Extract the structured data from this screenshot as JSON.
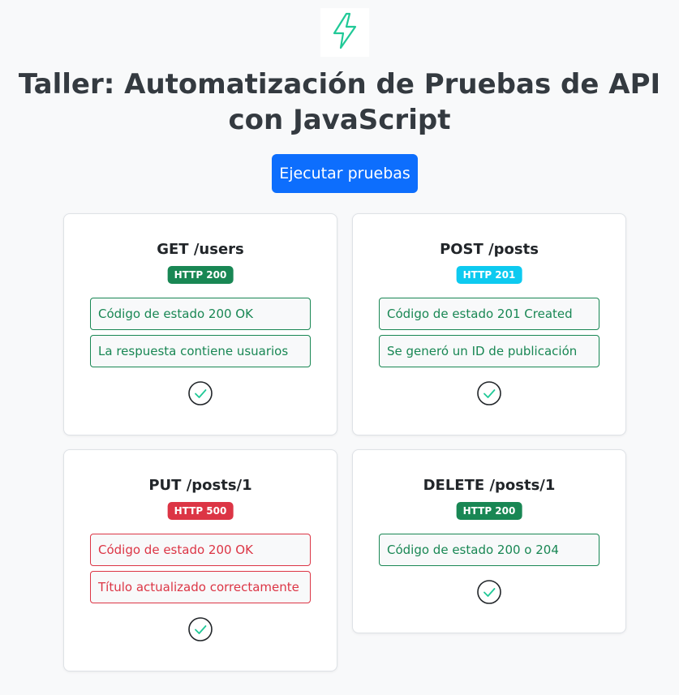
{
  "header": {
    "title": "Taller: Automatización de Pruebas de API con JavaScript",
    "run_button_label": "Ejecutar pruebas"
  },
  "colors": {
    "primary": "#0d6efd",
    "success": "#198754",
    "info": "#0dcaf0",
    "danger": "#dc3545",
    "icon_accent": "#20c997"
  },
  "cards": [
    {
      "title": "GET /users",
      "badge": "HTTP 200",
      "badge_color": "#198754",
      "checks": [
        {
          "text": "Código de estado 200 OK",
          "status": "pass"
        },
        {
          "text": "La respuesta contiene usuarios",
          "status": "pass"
        }
      ],
      "result_icon": "check-circle-icon"
    },
    {
      "title": "POST /posts",
      "badge": "HTTP 201",
      "badge_color": "#0dcaf0",
      "checks": [
        {
          "text": "Código de estado 201 Created",
          "status": "pass"
        },
        {
          "text": "Se generó un ID de publicación",
          "status": "pass"
        }
      ],
      "result_icon": "check-circle-icon"
    },
    {
      "title": "PUT /posts/1",
      "badge": "HTTP 500",
      "badge_color": "#dc3545",
      "checks": [
        {
          "text": "Código de estado 200 OK",
          "status": "fail"
        },
        {
          "text": "Título actualizado correctamente",
          "status": "fail"
        }
      ],
      "result_icon": "check-circle-icon"
    },
    {
      "title": "DELETE /posts/1",
      "badge": "HTTP 200",
      "badge_color": "#198754",
      "checks": [
        {
          "text": "Código de estado 200 o 204",
          "status": "pass"
        }
      ],
      "result_icon": "check-circle-icon"
    }
  ]
}
